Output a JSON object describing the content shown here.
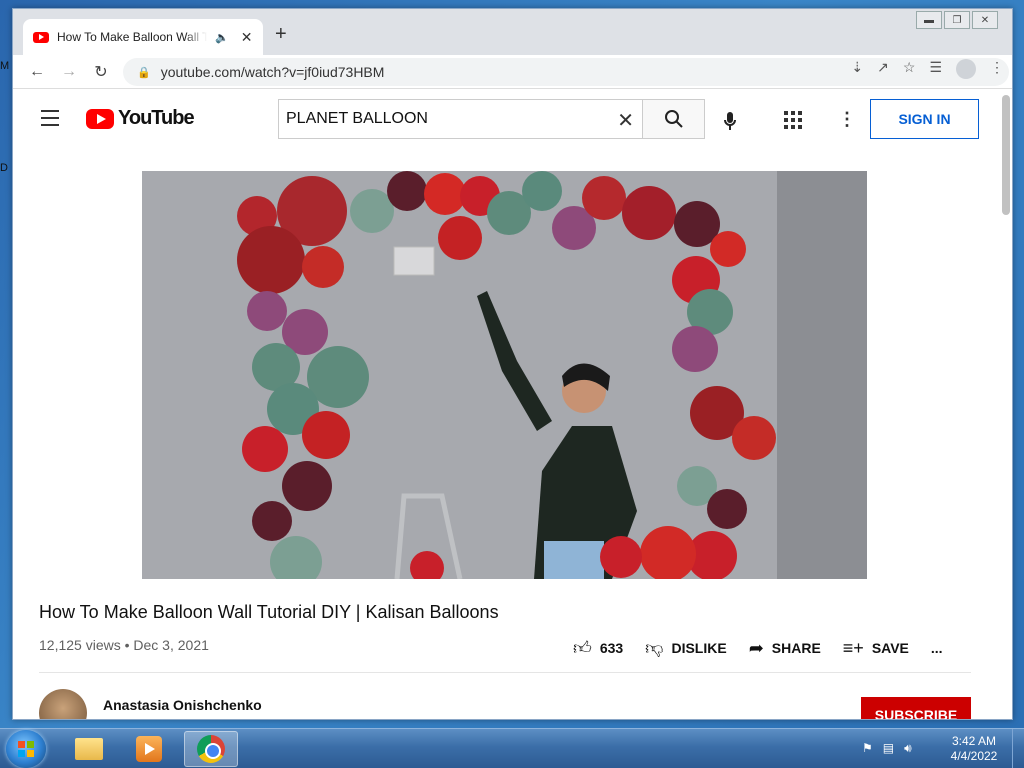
{
  "browser": {
    "tab_title": "How To Make Balloon Wall Tutorial DIY | Kalisan Balloons - YouTube",
    "new_tab": "+",
    "url": "youtube.com/watch?v=jf0iud73HBM",
    "window_controls": [
      "minimize",
      "restore",
      "close"
    ]
  },
  "youtube": {
    "logo_text": "YouTube",
    "search_value": "PLANET BALLOON",
    "sign_in": "SIGN IN",
    "video_title": "How To Make Balloon Wall Tutorial DIY | Kalisan Balloons",
    "views_date": "12,125 views • Dec 3, 2021",
    "likes": "633",
    "dislike": "DISLIKE",
    "share": "SHARE",
    "save": "SAVE",
    "more": "...",
    "channel_name": "Anastasia Onishchenko",
    "subscribe": "SUBSCRIBE"
  },
  "desktop": {
    "edge_letters": [
      "M",
      "D"
    ]
  },
  "taskbar": {
    "apps": [
      "windows-explorer",
      "media-player",
      "google-chrome"
    ],
    "active_app": "google-chrome",
    "time": "3:42 AM",
    "date": "4/4/2022"
  },
  "colors": {
    "youtube_red": "#ff0000",
    "subscribe_red": "#cc0000",
    "link_blue": "#065fd4",
    "balloon_red": "#c8202a",
    "balloon_green": "#5e8b7c",
    "balloon_burgundy": "#5a1e2b",
    "balloon_plum": "#8e4a7a"
  }
}
